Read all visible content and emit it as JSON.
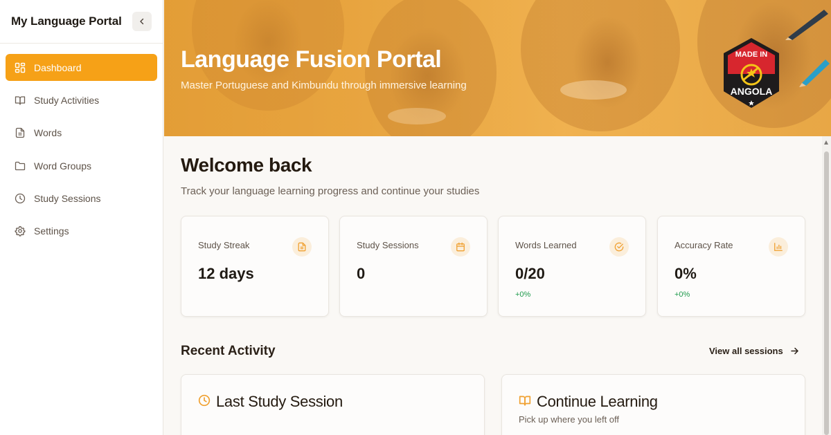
{
  "sidebar": {
    "title": "My Language Portal",
    "items": [
      {
        "label": "Dashboard",
        "icon": "dashboard-icon"
      },
      {
        "label": "Study Activities",
        "icon": "book-icon"
      },
      {
        "label": "Words",
        "icon": "document-icon"
      },
      {
        "label": "Word Groups",
        "icon": "folder-icon"
      },
      {
        "label": "Study Sessions",
        "icon": "clock-icon"
      },
      {
        "label": "Settings",
        "icon": "gear-icon"
      }
    ]
  },
  "hero": {
    "title": "Language Fusion Portal",
    "subtitle": "Master Portuguese and Kimbundu through immersive learning",
    "badge": {
      "top_text": "MADE IN",
      "bottom_text": "ANGOLA"
    }
  },
  "main": {
    "welcome_title": "Welcome back",
    "welcome_subtitle": "Track your language learning progress and continue your studies",
    "stats": [
      {
        "label": "Study Streak",
        "value": "12 days",
        "delta": "",
        "icon": "document-icon"
      },
      {
        "label": "Study Sessions",
        "value": "0",
        "delta": "",
        "icon": "calendar-icon"
      },
      {
        "label": "Words Learned",
        "value": "0/20",
        "delta": "+0%",
        "icon": "check-circle-icon"
      },
      {
        "label": "Accuracy Rate",
        "value": "0%",
        "delta": "+0%",
        "icon": "bar-chart-icon"
      }
    ],
    "recent_activity": {
      "title": "Recent Activity",
      "view_all_label": "View all sessions"
    },
    "cards": [
      {
        "title": "Last Study Session",
        "subtitle": "",
        "icon": "clock-icon"
      },
      {
        "title": "Continue Learning",
        "subtitle": "Pick up where you left off",
        "icon": "book-icon"
      }
    ]
  },
  "colors": {
    "accent": "#f6a117",
    "positive": "#1e9a4b"
  }
}
